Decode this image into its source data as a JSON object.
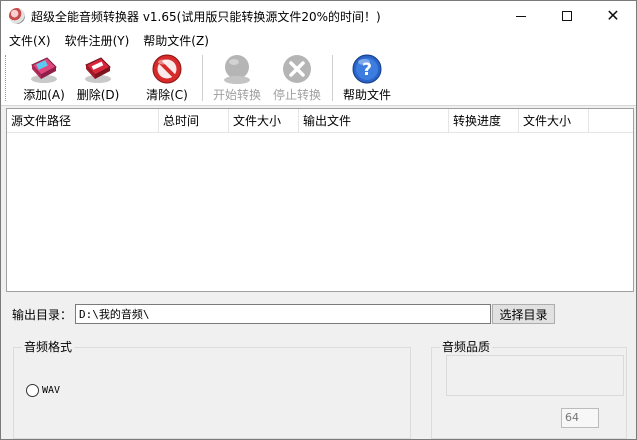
{
  "window": {
    "title": "超级全能音频转换器 v1.65(试用版只能转换源文件20%的时间！)"
  },
  "menu": [
    "文件(X)",
    "软件注册(Y)",
    "帮助文件(Z)"
  ],
  "toolbar": {
    "add": "添加(A)",
    "delete": "删除(D)",
    "clear": "清除(C)",
    "start": "开始转换",
    "stop": "停止转换",
    "help": "帮助文件"
  },
  "list": {
    "columns": [
      "源文件路径",
      "总时间",
      "文件大小",
      "输出文件",
      "转换进度",
      "文件大小"
    ],
    "rows": []
  },
  "output": {
    "label": "输出目录：",
    "value": "D:\\我的音频\\",
    "choose_button": "选择目录"
  },
  "format_group": {
    "title": "音频格式",
    "option": "WAV"
  },
  "quality_group": {
    "title": "音频品质",
    "value": "64"
  },
  "colors": {
    "window_bg": "#f0f0f0",
    "add_icon": "#e0457b",
    "delete_icon": "#d6283a",
    "clear_icon": "#d72b2b",
    "help_icon": "#2a64c8",
    "disabled_icon": "#b5b5b5"
  },
  "icons": {
    "app": "audio-disc-icon",
    "add": "add-file-icon",
    "delete": "delete-file-icon",
    "clear": "clear-icon",
    "start": "start-convert-icon",
    "stop": "stop-convert-icon",
    "help": "help-icon"
  }
}
